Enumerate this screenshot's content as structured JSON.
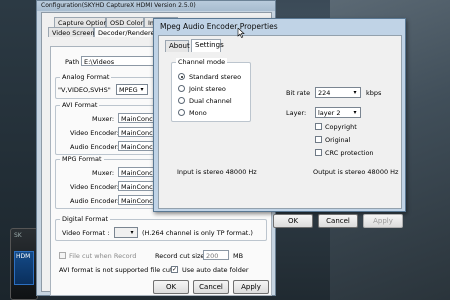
{
  "main_window": {
    "title": "Configuration(SKYHD CaptureX HDMI Version 2.5.0)",
    "tabs_row1": [
      "Capture Option",
      "OSD Color",
      "Image S"
    ],
    "tabs_row2": [
      "Video Screen",
      "Decoder/Renderer"
    ],
    "path_label": "Path",
    "path_value": "E:\\Videos",
    "analog_format": {
      "title": "Analog Format",
      "source": "\"V,VIDEO,SVHS\"",
      "format": "MPEG"
    },
    "avi_format": {
      "title": "AVI Format",
      "muxer_label": "Muxer:",
      "muxer_value": "MainConcept MP",
      "video_label": "Video Encoder:",
      "video_value": "MainConcept MP",
      "audio_label": "Audio Encoder:",
      "audio_value": "MainConcept La"
    },
    "mpg_format": {
      "title": "MPG Format",
      "muxer_label": "Muxer:",
      "muxer_value": "MainConcept MP",
      "video_label": "Video Encoder:",
      "video_value": "MainConcept MP",
      "audio_label": "Audio Encoder:",
      "audio_value": "MainConcept La"
    },
    "digital_format": {
      "title": "Digital Format",
      "video_label": "Video Format :",
      "note": "(H.264 channel is only TP format.)"
    },
    "file_cut_label": "File cut when Record",
    "record_cut_label": "Record cut size",
    "record_cut_value": "200",
    "record_cut_unit": "MB",
    "avi_note": "AVI format is not supported file cut",
    "auto_date_label": "Use auto date folder",
    "ok": "OK",
    "cancel": "Cancel",
    "apply": "Apply"
  },
  "dialog": {
    "title": "Mpeg Audio Encoder Properties",
    "tabs": [
      "About",
      "Settings"
    ],
    "channel_mode": {
      "title": "Channel mode",
      "options": [
        "Standard stereo",
        "Joint stereo",
        "Dual channel",
        "Mono"
      ],
      "selected": "Standard stereo"
    },
    "bit_rate_label": "Bit rate",
    "bit_rate_value": "224",
    "bit_rate_unit": "kbps",
    "layer_label": "Layer:",
    "layer_value": "layer 2",
    "copyright_label": "Copyright",
    "original_label": "Original",
    "crc_label": "CRC protection",
    "input_text": "Input is stereo 48000 Hz",
    "output_text": "Output is stereo 48000 Hz",
    "ok": "OK",
    "cancel": "Cancel",
    "apply": "Apply"
  },
  "device": {
    "brand": "SK",
    "screen_text": "HDM"
  }
}
